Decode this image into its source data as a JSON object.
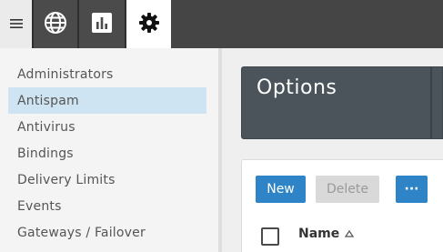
{
  "topbar": {
    "menu_icon": "hamburger-icon",
    "nav": [
      {
        "icon": "globe-icon",
        "active": false
      },
      {
        "icon": "bar-chart-icon",
        "active": false
      },
      {
        "icon": "gear-icon",
        "active": true
      }
    ]
  },
  "sidebar": {
    "items": [
      {
        "label": "Administrators",
        "active": false
      },
      {
        "label": "Antispam",
        "active": true
      },
      {
        "label": "Antivirus",
        "active": false
      },
      {
        "label": "Bindings",
        "active": false
      },
      {
        "label": "Delivery Limits",
        "active": false
      },
      {
        "label": "Events",
        "active": false
      },
      {
        "label": "Gateways / Failover",
        "active": false
      }
    ]
  },
  "main": {
    "title": "Options",
    "toolbar": {
      "new_label": "New",
      "delete_label": "Delete",
      "more_label": "···"
    },
    "table": {
      "columns": [
        {
          "label": "Name",
          "sort": "ascending"
        }
      ]
    }
  },
  "colors": {
    "primary": "#2e84c6",
    "topnav": "#454545",
    "active_sidebar": "#cfe4f2",
    "options_card": "#4a545a"
  }
}
